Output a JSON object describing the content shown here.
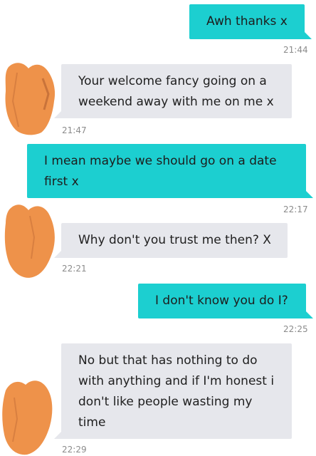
{
  "colors": {
    "sent_bubble": "#1ccfd0",
    "received_bubble": "#e6e7ec",
    "timestamp": "#8b8b8b",
    "avatar_redaction": "#ee924a",
    "background": "#ffffff"
  },
  "messages": [
    {
      "direction": "sent",
      "text": "Awh thanks x",
      "time": "21:44"
    },
    {
      "direction": "received",
      "text": "Your welcome fancy going on a weekend away with me on me x",
      "time": "21:47"
    },
    {
      "direction": "sent",
      "text": "I mean maybe we should go on a date first x",
      "time": "22:17"
    },
    {
      "direction": "received",
      "text": "Why don't you trust me then? X",
      "time": "22:21"
    },
    {
      "direction": "sent",
      "text": "I don't know you do I?",
      "time": "22:25"
    },
    {
      "direction": "received",
      "text": "No but that has nothing to do with anything and if I'm honest i don't like people wasting my time",
      "time": "22:29"
    }
  ]
}
